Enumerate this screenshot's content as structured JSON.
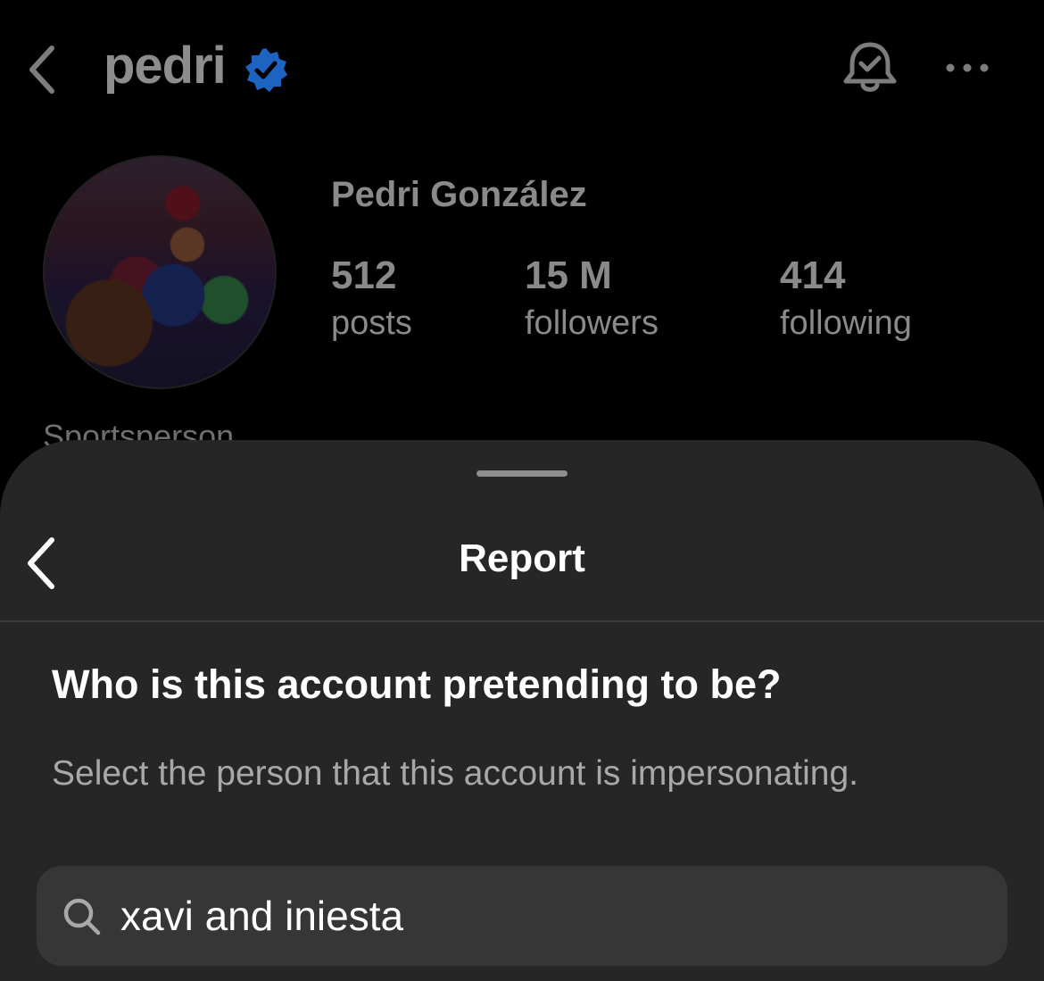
{
  "header": {
    "username": "pedri",
    "verified": true,
    "icons": [
      "back-icon",
      "verified-badge-icon",
      "bell-icon",
      "more-icon"
    ]
  },
  "profile": {
    "display_name": "Pedri González",
    "stats": [
      {
        "value": "512",
        "label": "posts"
      },
      {
        "value": "15 M",
        "label": "followers"
      },
      {
        "value": "414",
        "label": "following"
      }
    ],
    "category": "Sportsperson"
  },
  "sheet": {
    "title": "Report",
    "question": "Who is this account pretending to be?",
    "subtext": "Select the person that this account is impersonating.",
    "search": {
      "value": "xavi and iniesta",
      "icon": "search-icon"
    }
  },
  "colors": {
    "verified_blue": "#1d64c2",
    "sheet_bg": "#262626",
    "search_bg": "#363636"
  }
}
